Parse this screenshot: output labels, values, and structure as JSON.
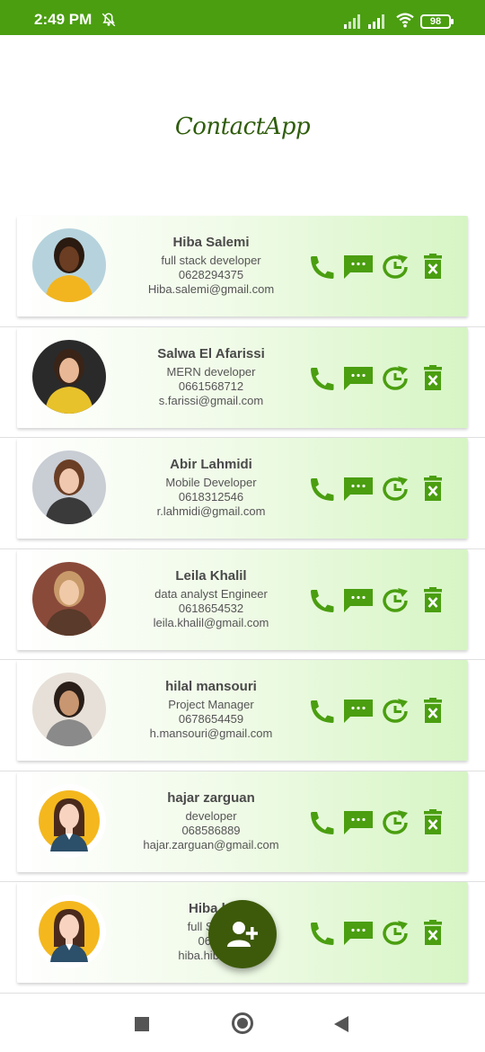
{
  "status_bar": {
    "time": "2:49 PM",
    "battery": "98",
    "icons": [
      "dnd-bell-off-icon",
      "signal-icon",
      "signal-icon",
      "wifi-icon",
      "battery-icon"
    ]
  },
  "app": {
    "title": "ContactApp",
    "accent_color": "#4a9e10",
    "dark_accent": "#3d5a0b"
  },
  "contacts": [
    {
      "name": "Hiba Salemi",
      "role": "full stack developer",
      "phone": "0628294375",
      "email": "Hiba.salemi@gmail.com"
    },
    {
      "name": "Salwa El Afarissi",
      "role": "MERN developer",
      "phone": "0661568712",
      "email": "s.farissi@gmail.com"
    },
    {
      "name": "Abir Lahmidi",
      "role": "Mobile Developer",
      "phone": "0618312546",
      "email": "r.lahmidi@gmail.com"
    },
    {
      "name": "Leila Khalil",
      "role": "data analyst Engineer",
      "phone": "0618654532",
      "email": "leila.khalil@gmail.com"
    },
    {
      "name": "hilal mansouri",
      "role": "Project Manager",
      "phone": "0678654459",
      "email": "h.mansouri@gmail.com"
    },
    {
      "name": "hajar zarguan",
      "role": "developer",
      "phone": "068586889",
      "email": "hajar.zarguan@gmail.com"
    },
    {
      "name": "Hiba hi",
      "role": "full Stack",
      "phone": "0685",
      "email": "hiba.hiba@g"
    }
  ],
  "actions": {
    "call": "call-icon",
    "message": "message-icon",
    "history": "history-icon",
    "delete": "delete-icon"
  },
  "fab": {
    "icon": "add-person-icon"
  },
  "nav": {
    "icons": [
      "recents-square-icon",
      "home-circle-icon",
      "back-triangle-icon"
    ]
  }
}
